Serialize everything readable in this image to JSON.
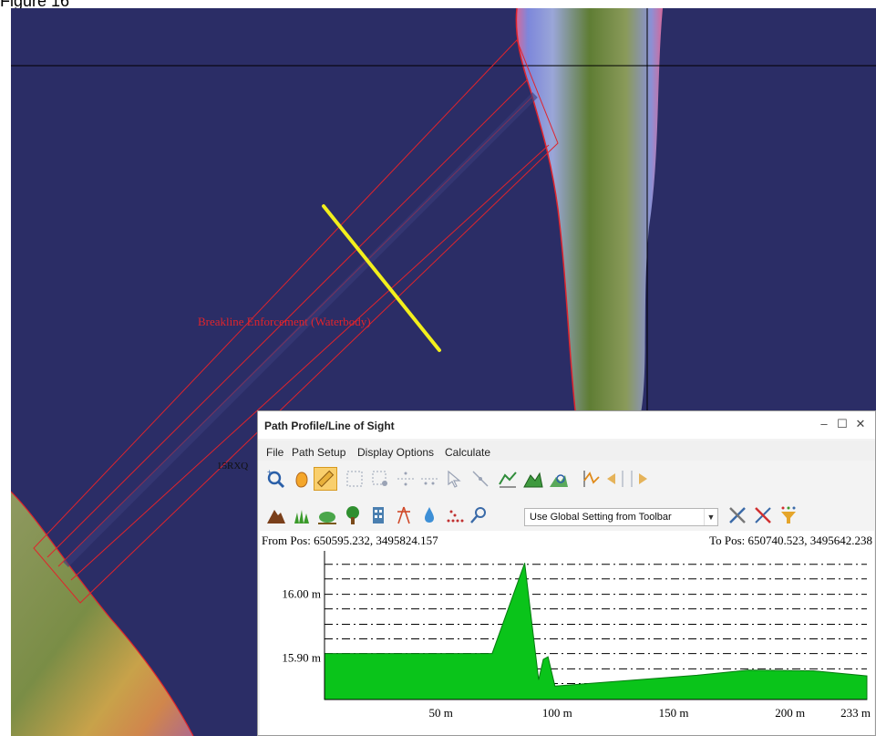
{
  "figure_label": "Figure 16",
  "map": {
    "breakline_label": "Breakline Enforcement (Waterbody)",
    "grid_label": "15RXQ"
  },
  "window": {
    "title": "Path Profile/Line of Sight",
    "minimize": "–",
    "maximize": "☐",
    "close": "✕"
  },
  "menu": [
    "File",
    "Path Setup",
    "Display Options",
    "Calculate"
  ],
  "toolbar1_icons": [
    "zoom-path-icon",
    "pan-hand-icon",
    "ruler-path-icon",
    "grid-points-icon",
    "grid-point-select-icon",
    "horizontal-split-icon",
    "vertical-split-icon",
    "cursor-arrow-icon",
    "line-point-icon",
    "profile-chart-icon",
    "terrain-fill-icon",
    "terrain-zoom-icon",
    "line-of-sight-icon",
    "shift-left-icon",
    "shift-right-icon"
  ],
  "toolbar2_icons": [
    "mountain-icon",
    "grass-icon",
    "shrub-icon",
    "tree-icon",
    "building-icon",
    "tower-icon",
    "water-drop-icon",
    "point-cloud-icon",
    "search-icon"
  ],
  "toolbar2_combo": "Use Global Setting from Toolbar",
  "toolbar2_extra_icons": [
    "settings-tools-icon",
    "clear-tools-icon",
    "filter-funnel-icon"
  ],
  "profile": {
    "from_pos": "From Pos: 650595.232, 3495824.157",
    "to_pos": "To Pos: 650740.523, 3495642.238"
  },
  "chart_data": {
    "type": "area",
    "x_unit": "m",
    "x_range": [
      0,
      233
    ],
    "y_range": [
      15.835,
      16.068
    ],
    "y_ticks": [
      {
        "value": 16.0,
        "label": "16.00 m"
      },
      {
        "value": 15.9,
        "label": "15.90 m"
      }
    ],
    "x_ticks": [
      {
        "value": 50,
        "label": "50 m"
      },
      {
        "value": 100,
        "label": "100 m"
      },
      {
        "value": 150,
        "label": "150 m"
      },
      {
        "value": 200,
        "label": "200 m"
      },
      {
        "value": 233,
        "label": "233 m"
      }
    ],
    "gridlines": [
      16.047,
      16.024,
      16.0,
      15.977,
      15.953,
      15.93,
      15.907,
      15.883,
      15.86
    ],
    "grid_style": "dash-dot",
    "fill_color": "#0ac41a",
    "x": [
      0,
      72,
      86,
      92,
      94,
      96,
      99,
      160,
      182,
      210,
      233
    ],
    "y": [
      15.907,
      15.907,
      16.049,
      15.866,
      15.898,
      15.902,
      15.856,
      15.873,
      15.881,
      15.88,
      15.872
    ]
  },
  "colors": {
    "water": "#2b2d66",
    "land_green": "#5f7d34",
    "land_blue_edge": "#7c87d8",
    "boundary_red": "#e0242c",
    "path_yellow": "#f2ef1c"
  }
}
